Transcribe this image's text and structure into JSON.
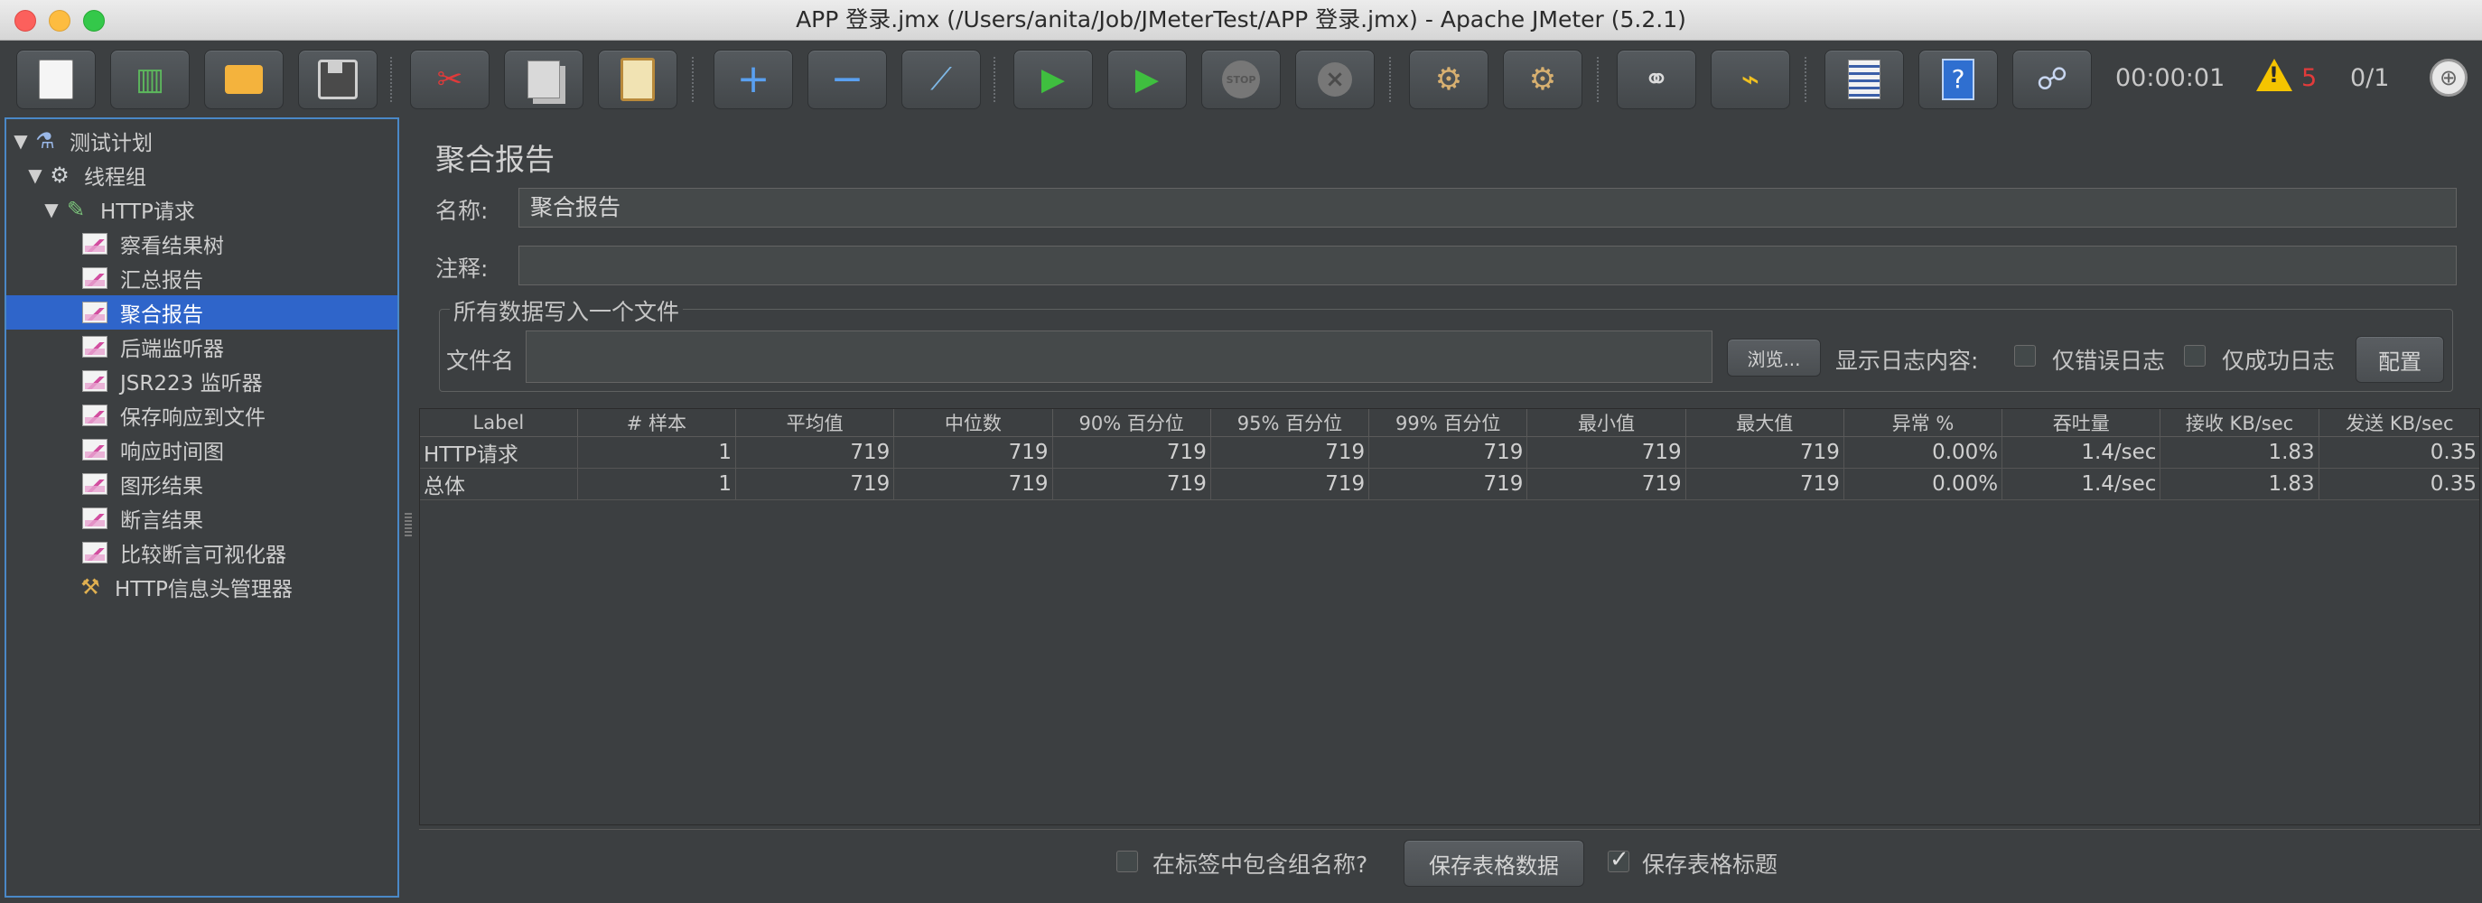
{
  "window": {
    "title": "APP 登录.jmx (/Users/anita/Job/JMeterTest/APP 登录.jmx) - Apache JMeter (5.2.1)"
  },
  "toolbar": {
    "buttons": [
      {
        "name": "new-icon"
      },
      {
        "name": "templates-icon"
      },
      {
        "name": "open-icon"
      },
      {
        "name": "save-icon"
      },
      {
        "name": "cut-icon"
      },
      {
        "name": "copy-icon"
      },
      {
        "name": "paste-icon"
      },
      {
        "name": "expand-icon"
      },
      {
        "name": "collapse-icon"
      },
      {
        "name": "toggle-icon"
      },
      {
        "name": "start-icon"
      },
      {
        "name": "start-no-pauses-icon"
      },
      {
        "name": "stop-icon"
      },
      {
        "name": "shutdown-icon"
      },
      {
        "name": "clear-icon"
      },
      {
        "name": "clear-all-icon"
      },
      {
        "name": "search-icon"
      },
      {
        "name": "reset-search-icon"
      },
      {
        "name": "function-helper-icon"
      },
      {
        "name": "help-icon"
      },
      {
        "name": "remote-icon"
      }
    ],
    "elapsed_time": "00:00:01",
    "warning_count": "5",
    "threads": "0/1"
  },
  "tree": {
    "items": [
      {
        "label": "测试计划",
        "icon": "test-plan-icon"
      },
      {
        "label": "线程组",
        "icon": "gear-icon"
      },
      {
        "label": "HTTP请求",
        "icon": "pipette-icon"
      },
      {
        "label": "察看结果树",
        "icon": "listener-icon"
      },
      {
        "label": "汇总报告",
        "icon": "listener-icon"
      },
      {
        "label": "聚合报告",
        "icon": "listener-icon",
        "selected": true
      },
      {
        "label": "后端监听器",
        "icon": "listener-icon"
      },
      {
        "label": "JSR223 监听器",
        "icon": "listener-icon"
      },
      {
        "label": "保存响应到文件",
        "icon": "listener-icon"
      },
      {
        "label": "响应时间图",
        "icon": "listener-icon"
      },
      {
        "label": "图形结果",
        "icon": "listener-icon"
      },
      {
        "label": "断言结果",
        "icon": "listener-icon"
      },
      {
        "label": "比较断言可视化器",
        "icon": "listener-icon"
      },
      {
        "label": "HTTP信息头管理器",
        "icon": "tools-icon"
      }
    ]
  },
  "panel": {
    "title": "聚合报告",
    "name_label": "名称:",
    "name_value": "聚合报告",
    "comment_label": "注释:",
    "comment_value": "",
    "file_section_title": "所有数据写入一个文件",
    "filename_label": "文件名",
    "filename_value": "",
    "browse_button": "浏览...",
    "log_content_label": "显示日志内容:",
    "errors_only_label": "仅错误日志",
    "success_only_label": "仅成功日志",
    "configure_button": "配置"
  },
  "table": {
    "columns": [
      "Label",
      "# 样本",
      "平均值",
      "中位数",
      "90% 百分位",
      "95% 百分位",
      "99% 百分位",
      "最小值",
      "最大值",
      "异常 %",
      "吞吐量",
      "接收 KB/sec",
      "发送 KB/sec"
    ],
    "rows": [
      [
        "HTTP请求",
        "1",
        "719",
        "719",
        "719",
        "719",
        "719",
        "719",
        "719",
        "0.00%",
        "1.4/sec",
        "1.83",
        "0.35"
      ],
      [
        "总体",
        "1",
        "719",
        "719",
        "719",
        "719",
        "719",
        "719",
        "719",
        "0.00%",
        "1.4/sec",
        "1.83",
        "0.35"
      ]
    ]
  },
  "footer": {
    "include_group_label": "在标签中包含组名称?",
    "include_group_checked": false,
    "save_table_button": "保存表格数据",
    "save_header_label": "保存表格标题",
    "save_header_checked": true
  },
  "colors": {
    "background": "#3c3f41",
    "selection": "#2f65ca",
    "focus_border": "#4a88c7",
    "warning": "#e23b3b"
  }
}
